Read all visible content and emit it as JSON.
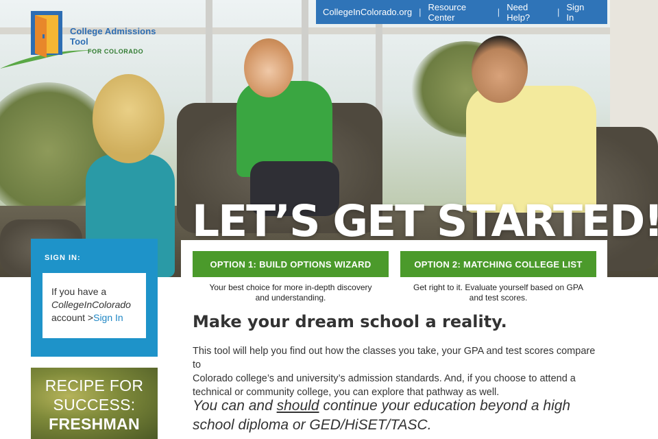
{
  "nav": {
    "items": [
      "CollegeInColorado.org",
      "Resource Center",
      "Need Help?",
      "Sign In"
    ],
    "separator": "|",
    "color": "#2f74b8"
  },
  "logo": {
    "title": "College Admissions Tool",
    "subtitle": "FOR COLORADO"
  },
  "hero": {
    "headline": "LET’S GET STARTED!"
  },
  "options": [
    {
      "label": "OPTION 1: BUILD OPTIONS WIZARD",
      "desc_line1": "Your best choice for more in-depth discovery",
      "desc_line2": "and understanding."
    },
    {
      "label": "OPTION 2: MATCHING COLLEGE LIST",
      "desc_line1": "Get right to it. Evaluate yourself based on GPA",
      "desc_line2": "and test scores."
    }
  ],
  "main": {
    "heading": "Make your dream school a reality.",
    "intro_line1": "This tool will help you find out how the classes you take, your GPA and test scores compare to",
    "intro_line2": "Colorado college’s and university’s admission standards. And, if you choose to attend a",
    "intro_line3": "technical or community college, you can explore that pathway as well.",
    "quote_pre": "You can and ",
    "quote_emph": "should",
    "quote_post": " continue your education beyond a high",
    "quote_line2": "school diploma or GED/HiSET/TASC."
  },
  "signin": {
    "title": "SIGN IN:",
    "text_line1": "If you have a",
    "brand": "CollegeInColorado",
    "text_line3": "account >",
    "link": "Sign In"
  },
  "promo": {
    "line1": "RECIPE FOR",
    "line2": "SUCCESS:",
    "line3": "FRESHMAN"
  },
  "colors": {
    "accent_green": "#4b9a2b",
    "signin_blue": "#1e93c9",
    "link_blue": "#1e86c4"
  }
}
